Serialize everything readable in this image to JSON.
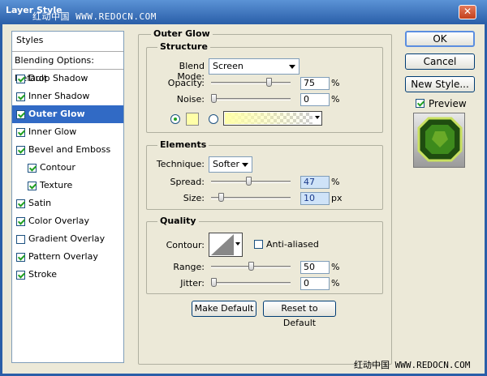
{
  "window": {
    "title": "Layer Style",
    "watermark_top": "红动中国 WWW.REDOCN.COM",
    "close": "✕"
  },
  "styles": {
    "header": "Styles",
    "blending_options": "Blending Options: Default",
    "items": [
      {
        "label": "Drop Shadow",
        "checked": true
      },
      {
        "label": "Inner Shadow",
        "checked": true
      },
      {
        "label": "Outer Glow",
        "checked": true,
        "selected": true
      },
      {
        "label": "Inner Glow",
        "checked": true
      },
      {
        "label": "Bevel and Emboss",
        "checked": true
      },
      {
        "label": "Contour",
        "checked": true,
        "indent": true
      },
      {
        "label": "Texture",
        "checked": true,
        "indent": true
      },
      {
        "label": "Satin",
        "checked": true
      },
      {
        "label": "Color Overlay",
        "checked": true
      },
      {
        "label": "Gradient Overlay",
        "checked": false
      },
      {
        "label": "Pattern Overlay",
        "checked": true
      },
      {
        "label": "Stroke",
        "checked": true
      }
    ]
  },
  "panel": {
    "title": "Outer Glow",
    "structure": {
      "label": "Structure",
      "blend_mode_label": "Blend Mode:",
      "blend_mode_value": "Screen",
      "opacity_label": "Opacity:",
      "opacity_value": "75",
      "opacity_level": 0.75,
      "noise_label": "Noise:",
      "noise_value": "0",
      "noise_level": 0,
      "unit": "%",
      "glow_color": "#ffffa8"
    },
    "elements": {
      "label": "Elements",
      "technique_label": "Technique:",
      "technique_value": "Softer",
      "spread_label": "Spread:",
      "spread_value": "47",
      "spread_level": 0.47,
      "size_label": "Size:",
      "size_value": "10",
      "size_level": 0.1,
      "percent": "%",
      "px": "px"
    },
    "quality": {
      "label": "Quality",
      "contour_label": "Contour:",
      "anti_aliased_label": "Anti-aliased",
      "range_label": "Range:",
      "range_value": "50",
      "range_level": 0.5,
      "jitter_label": "Jitter:",
      "jitter_value": "0",
      "jitter_level": 0,
      "unit": "%"
    },
    "make_default": "Make Default",
    "reset_default": "Reset to Default"
  },
  "actions": {
    "ok": "OK",
    "cancel": "Cancel",
    "new_style": "New Style...",
    "preview_label": "Preview",
    "preview_checked": true
  },
  "watermark_bottom": "红动中国 WWW.REDOCN.COM"
}
